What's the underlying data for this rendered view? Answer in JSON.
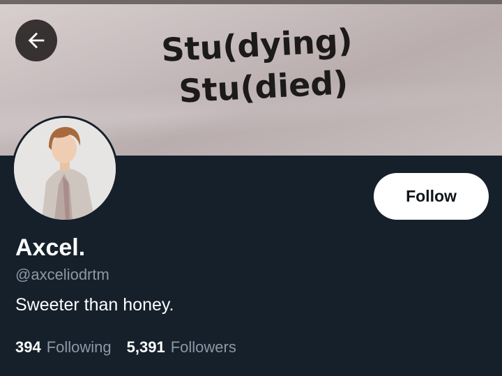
{
  "banner": {
    "line1": "Stu(dying)",
    "line2": "Stu(died)"
  },
  "nav": {
    "back_icon": "arrow-left-icon"
  },
  "profile": {
    "display_name": "Axcel.",
    "handle": "@axceliodrtm",
    "bio": "Sweeter than honey.",
    "follow_label": "Follow",
    "following_count": "394",
    "following_label": "Following",
    "followers_count": "5,391",
    "followers_label": "Followers"
  },
  "colors": {
    "background": "#15202b",
    "secondary_text": "#8b98a5",
    "primary_text": "#ffffff"
  }
}
